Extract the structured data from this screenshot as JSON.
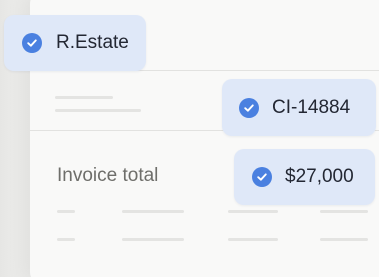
{
  "fields": {
    "account": {
      "value": "R.Estate",
      "verified": true
    },
    "invoice_id": {
      "value": "CI-14884",
      "verified": true
    },
    "invoice_total": {
      "label": "Invoice total",
      "value": "$27,000",
      "verified": true
    }
  },
  "icons": {
    "check": "check-circle-icon"
  },
  "colors": {
    "chip_bg": "#dfe8f8",
    "check_blue": "#4a80e0"
  }
}
